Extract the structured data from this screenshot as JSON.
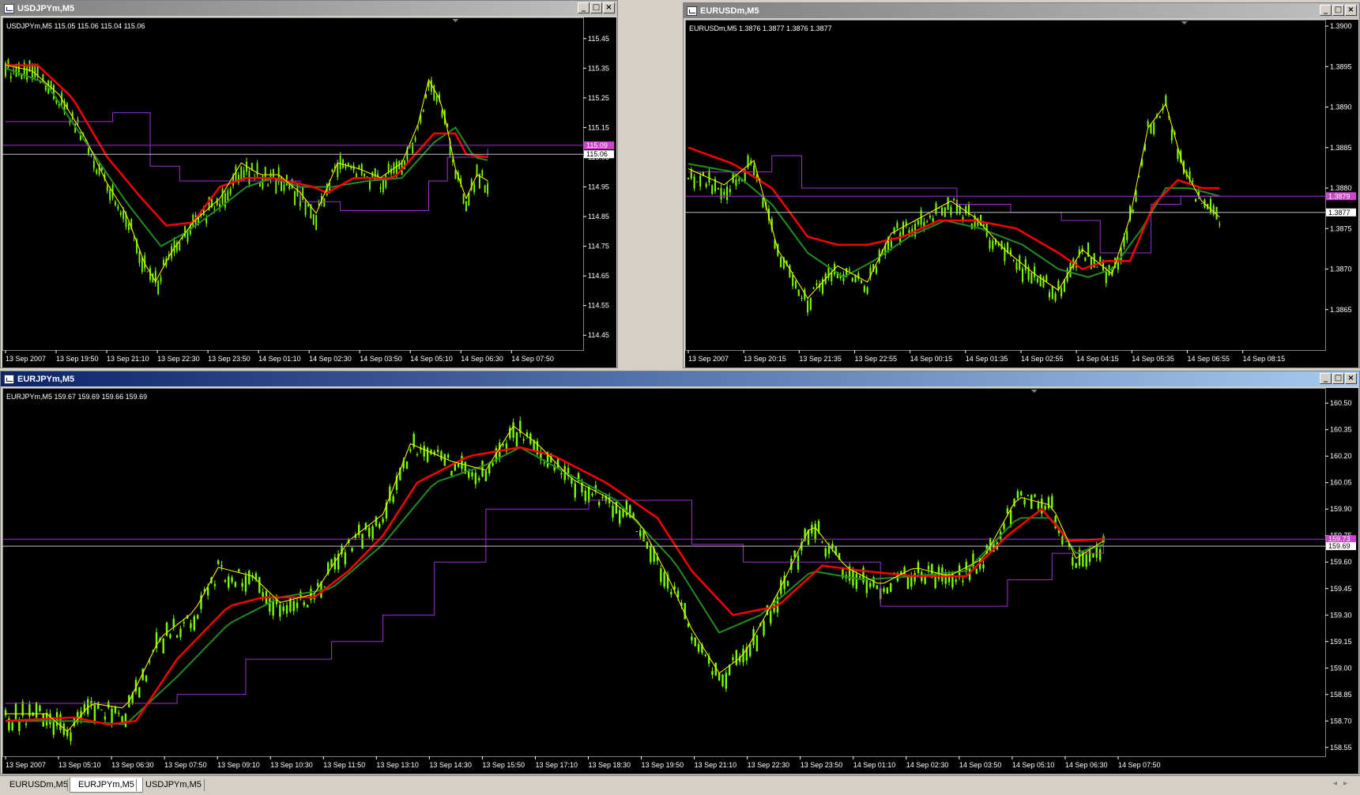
{
  "windows": [
    {
      "id": "usdjpy",
      "title": "USDJPYm,M5",
      "active": false,
      "header": "USDJPYm,M5  115.05 115.06 115.04 115.06",
      "ylim": [
        114.4,
        115.5
      ],
      "yticks": [
        "115.45",
        "115.35",
        "115.25",
        "115.15",
        "115.05",
        "114.95",
        "114.85",
        "114.75",
        "114.65",
        "114.55",
        "114.45"
      ],
      "ytick_values": [
        115.45,
        115.35,
        115.25,
        115.15,
        115.05,
        114.95,
        114.85,
        114.75,
        114.65,
        114.55,
        114.45
      ],
      "price_label": "115.06",
      "price_value": 115.06,
      "level_label": "115.09",
      "level_value": 115.09,
      "xticks": [
        "13 Sep 2007",
        "13 Sep 19:50",
        "13 Sep 21:10",
        "13 Sep 22:30",
        "13 Sep 23:50",
        "14 Sep 01:10",
        "14 Sep 02:30",
        "14 Sep 03:50",
        "14 Sep 05:10",
        "14 Sep 06:30",
        "14 Sep 07:50"
      ],
      "bars": 180,
      "price_path": [
        [
          0,
          115.35
        ],
        [
          10,
          115.33
        ],
        [
          20,
          115.25
        ],
        [
          30,
          115.1
        ],
        [
          38,
          114.95
        ],
        [
          45,
          114.85
        ],
        [
          52,
          114.68
        ],
        [
          56,
          114.62
        ],
        [
          62,
          114.72
        ],
        [
          70,
          114.82
        ],
        [
          80,
          114.9
        ],
        [
          88,
          115.02
        ],
        [
          95,
          114.98
        ],
        [
          102,
          114.98
        ],
        [
          110,
          114.92
        ],
        [
          116,
          114.85
        ],
        [
          124,
          115.02
        ],
        [
          132,
          115.0
        ],
        [
          140,
          114.97
        ],
        [
          148,
          115.02
        ],
        [
          154,
          115.15
        ],
        [
          158,
          115.3
        ],
        [
          163,
          115.22
        ],
        [
          168,
          115.0
        ],
        [
          172,
          114.9
        ],
        [
          176,
          114.98
        ],
        [
          180,
          114.96
        ]
      ],
      "red_path": [
        [
          0,
          115.36
        ],
        [
          12,
          115.36
        ],
        [
          25,
          115.25
        ],
        [
          38,
          115.05
        ],
        [
          50,
          114.92
        ],
        [
          60,
          114.82
        ],
        [
          70,
          114.83
        ],
        [
          80,
          114.95
        ],
        [
          90,
          114.98
        ],
        [
          100,
          114.98
        ],
        [
          115,
          114.95
        ],
        [
          120,
          114.93
        ],
        [
          130,
          114.98
        ],
        [
          145,
          114.98
        ],
        [
          160,
          115.13
        ],
        [
          168,
          115.13
        ],
        [
          172,
          115.06
        ],
        [
          180,
          115.05
        ]
      ],
      "green_path": [
        [
          0,
          115.35
        ],
        [
          15,
          115.3
        ],
        [
          30,
          115.1
        ],
        [
          45,
          114.9
        ],
        [
          58,
          114.75
        ],
        [
          68,
          114.8
        ],
        [
          80,
          114.88
        ],
        [
          90,
          114.95
        ],
        [
          100,
          114.98
        ],
        [
          110,
          114.95
        ],
        [
          122,
          114.95
        ],
        [
          135,
          114.97
        ],
        [
          148,
          114.98
        ],
        [
          160,
          115.1
        ],
        [
          168,
          115.15
        ],
        [
          175,
          115.05
        ],
        [
          180,
          115.04
        ]
      ],
      "purple_path": [
        [
          0,
          115.17
        ],
        [
          30,
          115.17
        ],
        [
          40,
          115.2
        ],
        [
          54,
          115.02
        ],
        [
          65,
          114.97
        ],
        [
          90,
          114.97
        ],
        [
          110,
          114.9
        ],
        [
          125,
          114.87
        ],
        [
          150,
          114.87
        ],
        [
          158,
          114.97
        ],
        [
          165,
          115.05
        ],
        [
          180,
          115.08
        ]
      ]
    },
    {
      "id": "eurusd",
      "title": "EURUSDm,M5",
      "active": false,
      "header": "EURUSDm,M5  1.3876 1.3877 1.3876 1.3877",
      "ylim": [
        1.386,
        1.39
      ],
      "yticks": [
        "1.3900",
        "1.3895",
        "1.3890",
        "1.3885",
        "1.3880",
        "1.3875",
        "1.3870",
        "1.3865"
      ],
      "ytick_values": [
        1.39,
        1.3895,
        1.389,
        1.3885,
        1.388,
        1.3875,
        1.387,
        1.3865
      ],
      "price_label": "1.3877",
      "price_value": 1.3877,
      "level_label": "1.3879",
      "level_value": 1.3879,
      "xticks": [
        "13 Sep 2007",
        "13 Sep 20:15",
        "13 Sep 21:35",
        "13 Sep 22:55",
        "14 Sep 00:15",
        "14 Sep 01:35",
        "14 Sep 02:55",
        "14 Sep 04:15",
        "14 Sep 05:35",
        "14 Sep 06:55",
        "14 Sep 08:15"
      ],
      "bars": 180,
      "price_path": [
        [
          0,
          1.3882
        ],
        [
          12,
          1.388
        ],
        [
          22,
          1.3883
        ],
        [
          30,
          1.3872
        ],
        [
          40,
          1.3866
        ],
        [
          50,
          1.387
        ],
        [
          60,
          1.3868
        ],
        [
          68,
          1.3874
        ],
        [
          78,
          1.3876
        ],
        [
          88,
          1.3878
        ],
        [
          96,
          1.3876
        ],
        [
          106,
          1.3872
        ],
        [
          116,
          1.3869
        ],
        [
          124,
          1.3867
        ],
        [
          132,
          1.3872
        ],
        [
          142,
          1.3869
        ],
        [
          148,
          1.3876
        ],
        [
          154,
          1.3887
        ],
        [
          160,
          1.389
        ],
        [
          166,
          1.3882
        ],
        [
          172,
          1.3878
        ],
        [
          178,
          1.3876
        ]
      ],
      "red_path": [
        [
          0,
          1.3885
        ],
        [
          15,
          1.3883
        ],
        [
          28,
          1.388
        ],
        [
          40,
          1.3874
        ],
        [
          50,
          1.3873
        ],
        [
          60,
          1.3873
        ],
        [
          72,
          1.3874
        ],
        [
          84,
          1.3876
        ],
        [
          96,
          1.3876
        ],
        [
          110,
          1.3875
        ],
        [
          124,
          1.3872
        ],
        [
          132,
          1.387
        ],
        [
          140,
          1.3871
        ],
        [
          148,
          1.3871
        ],
        [
          156,
          1.3878
        ],
        [
          164,
          1.3881
        ],
        [
          172,
          1.388
        ],
        [
          178,
          1.388
        ]
      ],
      "green_path": [
        [
          0,
          1.3883
        ],
        [
          15,
          1.3882
        ],
        [
          28,
          1.3878
        ],
        [
          40,
          1.3872
        ],
        [
          52,
          1.3869
        ],
        [
          62,
          1.3871
        ],
        [
          74,
          1.3874
        ],
        [
          86,
          1.3876
        ],
        [
          98,
          1.3875
        ],
        [
          112,
          1.3873
        ],
        [
          124,
          1.387
        ],
        [
          134,
          1.3869
        ],
        [
          142,
          1.387
        ],
        [
          152,
          1.3875
        ],
        [
          160,
          1.388
        ],
        [
          168,
          1.388
        ],
        [
          178,
          1.3879
        ]
      ],
      "purple_path": [
        [
          0,
          1.3882
        ],
        [
          25,
          1.3882
        ],
        [
          28,
          1.3884
        ],
        [
          38,
          1.388
        ],
        [
          60,
          1.388
        ],
        [
          75,
          1.388
        ],
        [
          90,
          1.3878
        ],
        [
          108,
          1.3877
        ],
        [
          125,
          1.3876
        ],
        [
          138,
          1.3872
        ],
        [
          148,
          1.3872
        ],
        [
          155,
          1.3878
        ],
        [
          165,
          1.3879
        ],
        [
          178,
          1.3879
        ]
      ]
    },
    {
      "id": "eurjpy",
      "title": "EURJPYm,M5",
      "active": true,
      "header": "EURJPYm,M5  159.67 159.69 159.66 159.69",
      "ylim": [
        158.5,
        160.55
      ],
      "yticks": [
        "160.50",
        "160.35",
        "160.20",
        "160.05",
        "159.90",
        "159.75",
        "159.60",
        "159.45",
        "159.30",
        "159.15",
        "159.00",
        "158.85",
        "158.70",
        "158.55"
      ],
      "ytick_values": [
        160.5,
        160.35,
        160.2,
        160.05,
        159.9,
        159.75,
        159.6,
        159.45,
        159.3,
        159.15,
        159.0,
        158.85,
        158.7,
        158.55
      ],
      "price_label": "159.69",
      "price_value": 159.69,
      "level_label": "159.73",
      "level_value": 159.73,
      "xticks": [
        "13 Sep 2007",
        "13 Sep 05:10",
        "13 Sep 06:30",
        "13 Sep 07:50",
        "13 Sep 09:10",
        "13 Sep 10:30",
        "13 Sep 11:50",
        "13 Sep 13:10",
        "13 Sep 14:30",
        "13 Sep 15:50",
        "13 Sep 17:10",
        "13 Sep 18:30",
        "13 Sep 19:50",
        "13 Sep 21:10",
        "13 Sep 22:30",
        "13 Sep 23:50",
        "14 Sep 01:10",
        "14 Sep 02:30",
        "14 Sep 03:50",
        "14 Sep 05:10",
        "14 Sep 06:30",
        "14 Sep 07:50"
      ],
      "bars": 330,
      "price_path": [
        [
          0,
          158.72
        ],
        [
          12,
          158.72
        ],
        [
          18,
          158.62
        ],
        [
          25,
          158.78
        ],
        [
          35,
          158.75
        ],
        [
          45,
          159.15
        ],
        [
          55,
          159.3
        ],
        [
          62,
          159.55
        ],
        [
          72,
          159.5
        ],
        [
          80,
          159.35
        ],
        [
          90,
          159.4
        ],
        [
          100,
          159.7
        ],
        [
          110,
          159.85
        ],
        [
          118,
          160.25
        ],
        [
          130,
          160.15
        ],
        [
          140,
          160.1
        ],
        [
          148,
          160.35
        ],
        [
          155,
          160.25
        ],
        [
          165,
          160.05
        ],
        [
          175,
          159.95
        ],
        [
          185,
          159.8
        ],
        [
          193,
          159.5
        ],
        [
          200,
          159.2
        ],
        [
          208,
          158.95
        ],
        [
          215,
          159.05
        ],
        [
          225,
          159.4
        ],
        [
          235,
          159.8
        ],
        [
          245,
          159.55
        ],
        [
          255,
          159.45
        ],
        [
          265,
          159.55
        ],
        [
          275,
          159.5
        ],
        [
          285,
          159.6
        ],
        [
          295,
          159.95
        ],
        [
          305,
          159.9
        ],
        [
          312,
          159.6
        ],
        [
          320,
          159.7
        ]
      ],
      "red_path": [
        [
          0,
          158.7
        ],
        [
          20,
          158.72
        ],
        [
          30,
          158.68
        ],
        [
          38,
          158.7
        ],
        [
          50,
          159.05
        ],
        [
          65,
          159.35
        ],
        [
          75,
          159.4
        ],
        [
          90,
          159.4
        ],
        [
          100,
          159.55
        ],
        [
          110,
          159.75
        ],
        [
          120,
          160.05
        ],
        [
          135,
          160.2
        ],
        [
          150,
          160.25
        ],
        [
          160,
          160.2
        ],
        [
          175,
          160.05
        ],
        [
          190,
          159.85
        ],
        [
          200,
          159.55
        ],
        [
          212,
          159.3
        ],
        [
          225,
          159.35
        ],
        [
          238,
          159.58
        ],
        [
          250,
          159.55
        ],
        [
          265,
          159.52
        ],
        [
          280,
          159.52
        ],
        [
          292,
          159.75
        ],
        [
          302,
          159.9
        ],
        [
          310,
          159.72
        ],
        [
          320,
          159.73
        ]
      ],
      "green_path": [
        [
          0,
          158.7
        ],
        [
          20,
          158.7
        ],
        [
          35,
          158.68
        ],
        [
          50,
          158.95
        ],
        [
          65,
          159.25
        ],
        [
          80,
          159.4
        ],
        [
          95,
          159.45
        ],
        [
          110,
          159.7
        ],
        [
          125,
          160.05
        ],
        [
          140,
          160.15
        ],
        [
          150,
          160.25
        ],
        [
          162,
          160.12
        ],
        [
          178,
          159.95
        ],
        [
          195,
          159.6
        ],
        [
          208,
          159.2
        ],
        [
          220,
          159.3
        ],
        [
          235,
          159.55
        ],
        [
          250,
          159.5
        ],
        [
          265,
          159.52
        ],
        [
          280,
          159.55
        ],
        [
          295,
          159.85
        ],
        [
          305,
          159.85
        ],
        [
          312,
          159.65
        ],
        [
          320,
          159.7
        ]
      ],
      "purple_path": [
        [
          0,
          158.8
        ],
        [
          35,
          158.8
        ],
        [
          50,
          158.85
        ],
        [
          70,
          159.05
        ],
        [
          95,
          159.15
        ],
        [
          110,
          159.3
        ],
        [
          125,
          159.6
        ],
        [
          140,
          159.9
        ],
        [
          170,
          159.95
        ],
        [
          185,
          159.95
        ],
        [
          200,
          159.7
        ],
        [
          215,
          159.6
        ],
        [
          235,
          159.6
        ],
        [
          255,
          159.35
        ],
        [
          280,
          159.35
        ],
        [
          292,
          159.5
        ],
        [
          305,
          159.65
        ],
        [
          320,
          159.75
        ]
      ]
    }
  ],
  "tabs": [
    {
      "label": "EURUSDm,M5",
      "active": false
    },
    {
      "label": "EURJPYm,M5",
      "active": true
    },
    {
      "label": "USDJPYm,M5",
      "active": false
    }
  ],
  "window_buttons": {
    "minimize": "_",
    "maximize": "□",
    "close": "×"
  },
  "colors": {
    "candle": "#7cfc00",
    "red_ma": "#ff0000",
    "yellow_ma": "#ffff00",
    "green_ma": "#228b22",
    "purple": "#9932cc",
    "price_line": "#c0c0c0",
    "level_bg": "#cc44cc",
    "axis_text": "#ffffff"
  },
  "chart_data": [
    {
      "type": "line",
      "title": "USDJPYm,M5",
      "xlabel": "",
      "ylabel": "",
      "ylim": [
        114.4,
        115.5
      ]
    },
    {
      "type": "line",
      "title": "EURUSDm,M5",
      "xlabel": "",
      "ylabel": "",
      "ylim": [
        1.386,
        1.39
      ]
    },
    {
      "type": "line",
      "title": "EURJPYm,M5",
      "xlabel": "",
      "ylabel": "",
      "ylim": [
        158.5,
        160.55
      ]
    }
  ]
}
